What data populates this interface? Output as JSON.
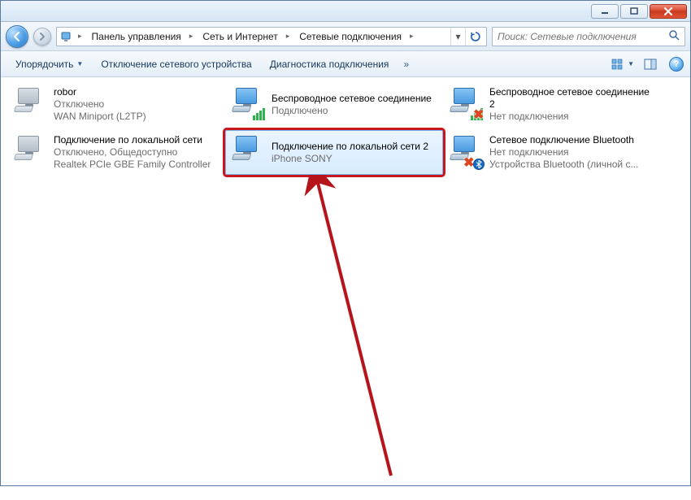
{
  "window": {
    "minimize": "–",
    "maximize": "▭",
    "close": "✕"
  },
  "breadcrumbs": {
    "items": [
      {
        "label": "Панель управления"
      },
      {
        "label": "Сеть и Интернет"
      },
      {
        "label": "Сетевые подключения"
      }
    ]
  },
  "search": {
    "placeholder": "Поиск: Сетевые подключения"
  },
  "toolbar": {
    "organize": "Упорядочить",
    "disable": "Отключение сетевого устройства",
    "diagnose": "Диагностика подключения",
    "more": "»"
  },
  "connections": [
    {
      "title": "robor",
      "status": "Отключено",
      "device": "WAN Miniport (L2TP)",
      "iconStyle": "grey",
      "overlay": ""
    },
    {
      "title": "Беспроводное сетевое соединение",
      "status": "Подключено",
      "device": "",
      "iconStyle": "",
      "overlay": "bars"
    },
    {
      "title": "Беспроводное сетевое соединение 2",
      "status": "Нет подключения",
      "device": "",
      "iconStyle": "",
      "overlay": "bars-cross"
    },
    {
      "title": "Подключение по локальной сети",
      "status": "Отключено, Общедоступно",
      "device": "Realtek PCIe GBE Family Controller",
      "iconStyle": "grey",
      "overlay": ""
    },
    {
      "title": "Подключение по локальной сети 2",
      "status": "",
      "device": "iPhone SONY",
      "iconStyle": "",
      "overlay": "",
      "selected": true,
      "highlight": true
    },
    {
      "title": "Сетевое подключение Bluetooth",
      "status": "Нет подключения",
      "device": "Устройства Bluetooth (личной с...",
      "iconStyle": "",
      "overlay": "bt-cross"
    }
  ]
}
